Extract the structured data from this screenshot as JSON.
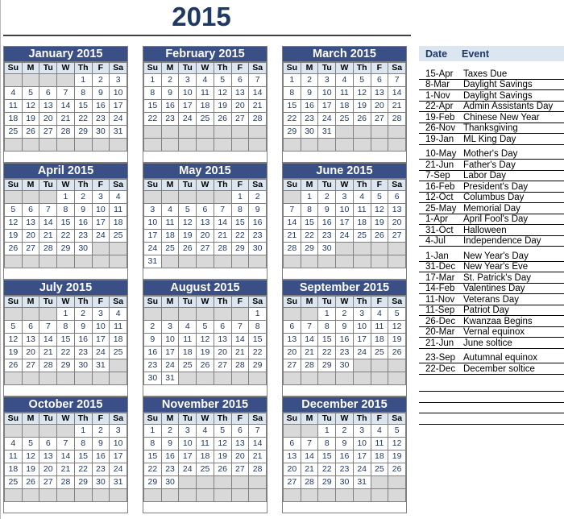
{
  "page": {
    "year_title": "2015"
  },
  "events_panel": {
    "header": {
      "date_label": "Date",
      "event_label": "Event"
    },
    "rows": [
      {
        "date": "15-Apr",
        "event": "Taxes Due"
      },
      {
        "date": "8-Mar",
        "event": "Daylight Savings"
      },
      {
        "date": "1-Nov",
        "event": "Daylight Savings"
      },
      {
        "date": "22-Apr",
        "event": "Admin Assistants Day"
      },
      {
        "date": "19-Feb",
        "event": "Chinese New Year"
      },
      {
        "date": "26-Nov",
        "event": "Thanksgiving"
      },
      {
        "date": "19-Jan",
        "event": "ML King Day"
      },
      {
        "date": "10-May",
        "event": "Mother's Day",
        "gap": true
      },
      {
        "date": "21-Jun",
        "event": "Father's Day"
      },
      {
        "date": "7-Sep",
        "event": "Labor Day"
      },
      {
        "date": "16-Feb",
        "event": "President's Day"
      },
      {
        "date": "12-Oct",
        "event": "Columbus Day"
      },
      {
        "date": "25-May",
        "event": "Memorial Day"
      },
      {
        "date": "1-Apr",
        "event": "April Fool's Day"
      },
      {
        "date": "31-Oct",
        "event": "Halloween"
      },
      {
        "date": "4-Jul",
        "event": "Independence Day"
      },
      {
        "date": "1-Jan",
        "event": "New Year's Day",
        "gap": true
      },
      {
        "date": "31-Dec",
        "event": "New Year's Eve"
      },
      {
        "date": "17-Mar",
        "event": "St. Patrick's Day"
      },
      {
        "date": "14-Feb",
        "event": "Valentines Day"
      },
      {
        "date": "11-Nov",
        "event": "Veterans Day"
      },
      {
        "date": "11-Sep",
        "event": "Patriot Day"
      },
      {
        "date": "26-Dec",
        "event": "Kwanzaa Begins"
      },
      {
        "date": "20-Mar",
        "event": "Vernal equinox"
      },
      {
        "date": "21-Jun",
        "event": "June soltice"
      },
      {
        "date": "23-Sep",
        "event": "Autumnal equinox",
        "gap": true
      },
      {
        "date": "22-Dec",
        "event": "December soltice"
      },
      {
        "date": "",
        "event": "",
        "empty": true
      },
      {
        "date": "",
        "event": ""
      },
      {
        "date": "",
        "event": ""
      },
      {
        "date": "",
        "event": ""
      }
    ]
  },
  "calendar": {
    "weekday_headers": [
      "Su",
      "M",
      "Tu",
      "W",
      "Th",
      "F",
      "Sa"
    ],
    "months": [
      {
        "title": "January 2015",
        "weeks": [
          [
            "",
            "",
            "",
            "",
            "1",
            "2",
            "3"
          ],
          [
            "4",
            "5",
            "6",
            "7",
            "8",
            "9",
            "10"
          ],
          [
            "11",
            "12",
            "13",
            "14",
            "15",
            "16",
            "17"
          ],
          [
            "18",
            "19",
            "20",
            "21",
            "22",
            "23",
            "24"
          ],
          [
            "25",
            "26",
            "27",
            "28",
            "29",
            "30",
            "31"
          ],
          [
            "",
            "",
            "",
            "",
            "",
            "",
            ""
          ]
        ]
      },
      {
        "title": "February 2015",
        "weeks": [
          [
            "1",
            "2",
            "3",
            "4",
            "5",
            "6",
            "7"
          ],
          [
            "8",
            "9",
            "10",
            "11",
            "12",
            "13",
            "14"
          ],
          [
            "15",
            "16",
            "17",
            "18",
            "19",
            "20",
            "21"
          ],
          [
            "22",
            "23",
            "24",
            "25",
            "26",
            "27",
            "28"
          ],
          [
            "",
            "",
            "",
            "",
            "",
            "",
            ""
          ],
          [
            "",
            "",
            "",
            "",
            "",
            "",
            ""
          ]
        ]
      },
      {
        "title": "March 2015",
        "weeks": [
          [
            "1",
            "2",
            "3",
            "4",
            "5",
            "6",
            "7"
          ],
          [
            "8",
            "9",
            "10",
            "11",
            "12",
            "13",
            "14"
          ],
          [
            "15",
            "16",
            "17",
            "18",
            "19",
            "20",
            "21"
          ],
          [
            "22",
            "23",
            "24",
            "25",
            "26",
            "27",
            "28"
          ],
          [
            "29",
            "30",
            "31",
            "",
            "",
            "",
            ""
          ],
          [
            "",
            "",
            "",
            "",
            "",
            "",
            ""
          ]
        ]
      },
      {
        "title": "April 2015",
        "weeks": [
          [
            "",
            "",
            "",
            "1",
            "2",
            "3",
            "4"
          ],
          [
            "5",
            "6",
            "7",
            "8",
            "9",
            "10",
            "11"
          ],
          [
            "12",
            "13",
            "14",
            "15",
            "16",
            "17",
            "18"
          ],
          [
            "19",
            "20",
            "21",
            "22",
            "23",
            "24",
            "25"
          ],
          [
            "26",
            "27",
            "28",
            "29",
            "30",
            "",
            ""
          ],
          [
            "",
            "",
            "",
            "",
            "",
            "",
            ""
          ]
        ]
      },
      {
        "title": "May 2015",
        "weeks": [
          [
            "",
            "",
            "",
            "",
            "",
            "1",
            "2"
          ],
          [
            "3",
            "4",
            "5",
            "6",
            "7",
            "8",
            "9"
          ],
          [
            "10",
            "11",
            "12",
            "13",
            "14",
            "15",
            "16"
          ],
          [
            "17",
            "18",
            "19",
            "20",
            "21",
            "22",
            "23"
          ],
          [
            "24",
            "25",
            "26",
            "27",
            "28",
            "29",
            "30"
          ],
          [
            "31",
            "",
            "",
            "",
            "",
            "",
            ""
          ]
        ]
      },
      {
        "title": "June 2015",
        "weeks": [
          [
            "",
            "1",
            "2",
            "3",
            "4",
            "5",
            "6"
          ],
          [
            "7",
            "8",
            "9",
            "10",
            "11",
            "12",
            "13"
          ],
          [
            "14",
            "15",
            "16",
            "17",
            "18",
            "19",
            "20"
          ],
          [
            "21",
            "22",
            "23",
            "24",
            "25",
            "26",
            "27"
          ],
          [
            "28",
            "29",
            "30",
            "",
            "",
            "",
            ""
          ],
          [
            "",
            "",
            "",
            "",
            "",
            "",
            ""
          ]
        ]
      },
      {
        "title": "July 2015",
        "weeks": [
          [
            "",
            "",
            "",
            "1",
            "2",
            "3",
            "4"
          ],
          [
            "5",
            "6",
            "7",
            "8",
            "9",
            "10",
            "11"
          ],
          [
            "12",
            "13",
            "14",
            "15",
            "16",
            "17",
            "18"
          ],
          [
            "19",
            "20",
            "21",
            "22",
            "23",
            "24",
            "25"
          ],
          [
            "26",
            "27",
            "28",
            "29",
            "30",
            "31",
            ""
          ],
          [
            "",
            "",
            "",
            "",
            "",
            "",
            ""
          ]
        ]
      },
      {
        "title": "August 2015",
        "weeks": [
          [
            "",
            "",
            "",
            "",
            "",
            "",
            "1"
          ],
          [
            "2",
            "3",
            "4",
            "5",
            "6",
            "7",
            "8"
          ],
          [
            "9",
            "10",
            "11",
            "12",
            "13",
            "14",
            "15"
          ],
          [
            "16",
            "17",
            "18",
            "19",
            "20",
            "21",
            "22"
          ],
          [
            "23",
            "24",
            "25",
            "26",
            "27",
            "28",
            "29"
          ],
          [
            "30",
            "31",
            "",
            "",
            "",
            "",
            ""
          ]
        ]
      },
      {
        "title": "September 2015",
        "weeks": [
          [
            "",
            "",
            "1",
            "2",
            "3",
            "4",
            "5"
          ],
          [
            "6",
            "7",
            "8",
            "9",
            "10",
            "11",
            "12"
          ],
          [
            "13",
            "14",
            "15",
            "16",
            "17",
            "18",
            "19"
          ],
          [
            "20",
            "21",
            "22",
            "23",
            "24",
            "25",
            "26"
          ],
          [
            "27",
            "28",
            "29",
            "30",
            "",
            "",
            ""
          ],
          [
            "",
            "",
            "",
            "",
            "",
            "",
            ""
          ]
        ]
      },
      {
        "title": "October 2015",
        "weeks": [
          [
            "",
            "",
            "",
            "",
            "1",
            "2",
            "3"
          ],
          [
            "4",
            "5",
            "6",
            "7",
            "8",
            "9",
            "10"
          ],
          [
            "11",
            "12",
            "13",
            "14",
            "15",
            "16",
            "17"
          ],
          [
            "18",
            "19",
            "20",
            "21",
            "22",
            "23",
            "24"
          ],
          [
            "25",
            "26",
            "27",
            "28",
            "29",
            "30",
            "31"
          ],
          [
            "",
            "",
            "",
            "",
            "",
            "",
            ""
          ]
        ]
      },
      {
        "title": "November 2015",
        "weeks": [
          [
            "1",
            "2",
            "3",
            "4",
            "5",
            "6",
            "7"
          ],
          [
            "8",
            "9",
            "10",
            "11",
            "12",
            "13",
            "14"
          ],
          [
            "15",
            "16",
            "17",
            "18",
            "19",
            "20",
            "21"
          ],
          [
            "22",
            "23",
            "24",
            "25",
            "26",
            "27",
            "28"
          ],
          [
            "29",
            "30",
            "",
            "",
            "",
            "",
            ""
          ],
          [
            "",
            "",
            "",
            "",
            "",
            "",
            ""
          ]
        ]
      },
      {
        "title": "December 2015",
        "weeks": [
          [
            "",
            "",
            "1",
            "2",
            "3",
            "4",
            "5"
          ],
          [
            "6",
            "7",
            "8",
            "9",
            "10",
            "11",
            "12"
          ],
          [
            "13",
            "14",
            "15",
            "16",
            "17",
            "18",
            "19"
          ],
          [
            "20",
            "21",
            "22",
            "23",
            "24",
            "25",
            "26"
          ],
          [
            "27",
            "28",
            "29",
            "30",
            "31",
            "",
            ""
          ],
          [
            "",
            "",
            "",
            "",
            "",
            "",
            ""
          ]
        ]
      }
    ]
  },
  "colors": {
    "month_header_bg": "#3a4f86",
    "weekday_header_bg": "#dce6f1",
    "blank_day_bg": "#d9d9d9",
    "day_text": "#1f3864",
    "title_text": "#1f3864"
  }
}
